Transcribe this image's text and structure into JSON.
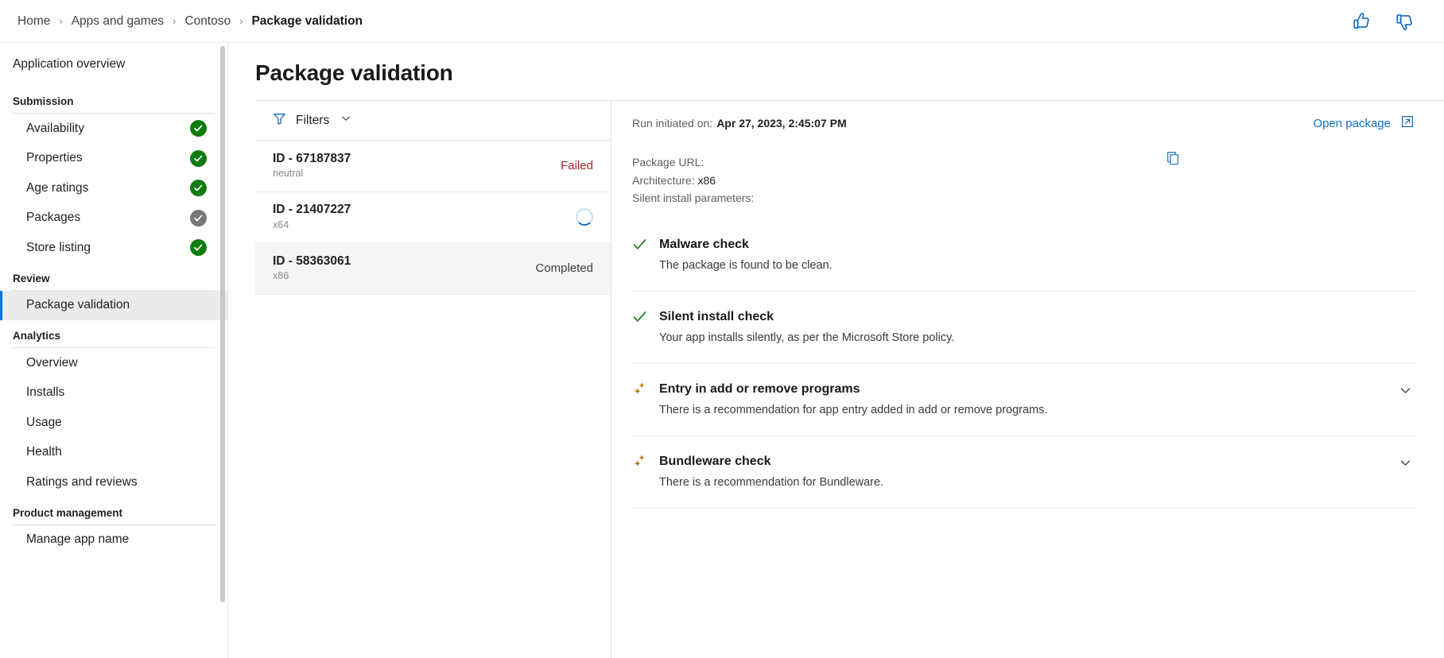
{
  "breadcrumb": {
    "items": [
      {
        "label": "Home",
        "current": false
      },
      {
        "label": "Apps and games",
        "current": false
      },
      {
        "label": "Contoso",
        "current": false
      },
      {
        "label": "Package validation",
        "current": true
      }
    ],
    "separator": "›"
  },
  "topbar": {
    "thumbs_up": "thumbs-up-icon",
    "thumbs_down": "thumbs-down-icon",
    "icon_color": "#0f6cbd"
  },
  "sidebar": {
    "overview_label": "Application overview",
    "scrollbar": "vertical-scrollbar",
    "groups": [
      {
        "title": "Submission",
        "items": [
          {
            "label": "Availability",
            "status": "green",
            "active": false
          },
          {
            "label": "Properties",
            "status": "green",
            "active": false
          },
          {
            "label": "Age ratings",
            "status": "green",
            "active": false
          },
          {
            "label": "Packages",
            "status": "gray",
            "active": false
          },
          {
            "label": "Store listing",
            "status": "green",
            "active": false
          }
        ]
      },
      {
        "title": "Review",
        "items": [
          {
            "label": "Package validation",
            "status": "none",
            "active": true
          }
        ]
      },
      {
        "title": "Analytics",
        "items": [
          {
            "label": "Overview",
            "status": "none",
            "active": false
          },
          {
            "label": "Installs",
            "status": "none",
            "active": false
          },
          {
            "label": "Usage",
            "status": "none",
            "active": false
          },
          {
            "label": "Health",
            "status": "none",
            "active": false
          },
          {
            "label": "Ratings and reviews",
            "status": "none",
            "active": false
          }
        ]
      },
      {
        "title": "Product management",
        "items": [
          {
            "label": "Manage app name",
            "status": "none",
            "active": false
          }
        ]
      }
    ],
    "status_colors": {
      "green": "#107c10",
      "gray": "#797775"
    },
    "active_accent": "#0078d4"
  },
  "page": {
    "title": "Package validation"
  },
  "list_pane": {
    "filters_label": "Filters",
    "filter_icon": "funnel-icon",
    "chevron_icon": "chevron-down-icon",
    "packages": [
      {
        "id": "ID - 67187837",
        "arch": "neutral",
        "status": "Failed",
        "status_kind": "failed",
        "selected": false
      },
      {
        "id": "ID - 21407227",
        "arch": "x64",
        "status": "",
        "status_kind": "running",
        "selected": false
      },
      {
        "id": "ID - 58363061",
        "arch": "x86",
        "status": "Completed",
        "status_kind": "completed",
        "selected": true
      }
    ],
    "failed_color": "#a4262c"
  },
  "detail": {
    "run_initiated_label": "Run initiated on:",
    "run_initiated_value": "Apr 27, 2023, 2:45:07 PM",
    "open_package_label": "Open package",
    "open_package_icon": "external-link-icon",
    "copy_icon": "copy-icon",
    "package_url_label": "Package URL:",
    "package_url_value": "",
    "architecture_label": "Architecture:",
    "architecture_value": "x86",
    "silent_install_label": "Silent install parameters:",
    "silent_install_value": "",
    "checks": [
      {
        "title": "Malware check",
        "desc": "The package is found to be clean.",
        "icon": "check-icon",
        "kind": "pass",
        "expandable": false
      },
      {
        "title": "Silent install check",
        "desc": "Your app installs silently, as per the Microsoft Store policy.",
        "icon": "check-icon",
        "kind": "pass",
        "expandable": false
      },
      {
        "title": "Entry in add or remove programs",
        "desc": "There is a recommendation for app entry added in add or remove programs.",
        "icon": "sparkle-icon",
        "kind": "recommendation",
        "expandable": true
      },
      {
        "title": "Bundleware check",
        "desc": "There is a recommendation for Bundleware.",
        "icon": "sparkle-icon",
        "kind": "recommendation",
        "expandable": true
      }
    ],
    "pass_color": "#107c10",
    "recommendation_color": "#b07d23",
    "link_color": "#0f6cbd"
  }
}
